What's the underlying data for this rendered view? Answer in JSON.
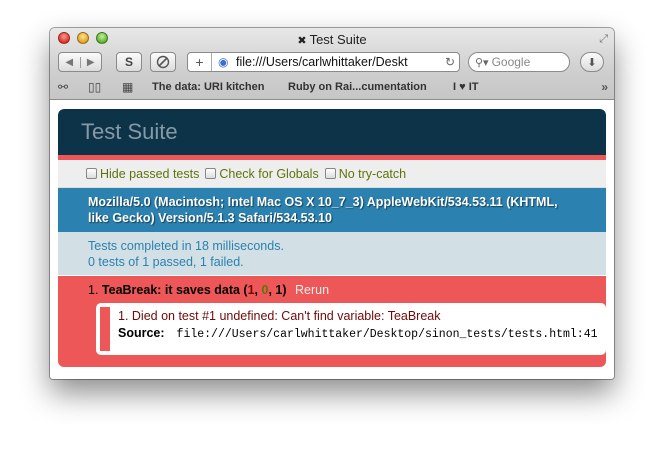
{
  "window": {
    "title": "Test Suite",
    "title_icon": "close-x-icon"
  },
  "toolbar": {
    "back_icon": "back-arrow-icon",
    "forward_icon": "forward-arrow-icon",
    "s_button": "S",
    "address_plus": "+",
    "address_url": "file:///Users/carlwhittaker/Deskt",
    "search_placeholder": "Google"
  },
  "bookmarks": {
    "items": [
      "The data: URI kitchen",
      "Ruby on Rai...cumentation",
      "I ♥ IT"
    ],
    "more": "»"
  },
  "qunit": {
    "header": "Test Suite",
    "options": [
      "Hide passed tests",
      "Check for Globals",
      "No try-catch"
    ],
    "user_agent": "Mozilla/5.0 (Macintosh; Intel Mac OS X 10_7_3) AppleWebKit/534.53.11 (KHTML, like Gecko) Version/5.1.3 Safari/534.53.10",
    "result_line1": "Tests completed in 18 milliseconds.",
    "result_line2": "0 tests of 1 passed, 1 failed.",
    "test": {
      "number": "1. ",
      "name": "TeaBreak: it saves data",
      "open": " (",
      "failed": "1",
      "sep1": ", ",
      "passed": "0",
      "sep2": ", ",
      "total": "1",
      "close": ")",
      "rerun": "Rerun"
    },
    "assertion": {
      "message": "1. Died on test #1 undefined: Can't find variable: TeaBreak",
      "source_label": "Source:",
      "source_path": "file:///Users/carlwhittaker/Desktop/sinon_tests/tests.html:41"
    }
  },
  "colors": {
    "header_bg": "#0d3349",
    "banner_fail": "#ee5757",
    "ua_bg": "#2b81af",
    "result_bg": "#d2e0e6",
    "fail_text": "#710909",
    "pass_text": "#5e740b"
  }
}
